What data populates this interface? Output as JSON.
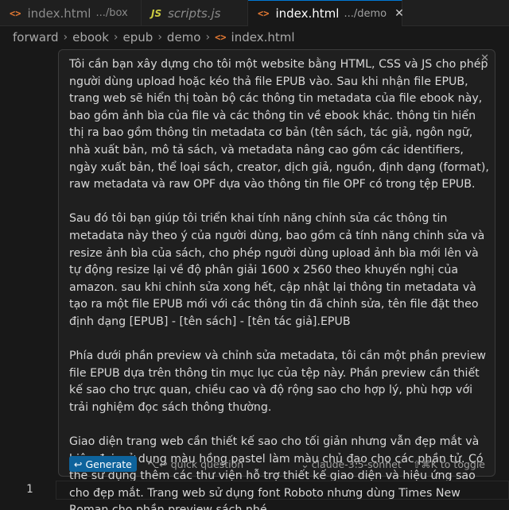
{
  "tabs": [
    {
      "icon": "<>",
      "name": "index.html",
      "desc": ".../box"
    },
    {
      "icon": "JS",
      "name": "scripts.js",
      "desc": ""
    },
    {
      "icon": "<>",
      "name": "index.html",
      "desc": ".../demo",
      "close": "✕"
    }
  ],
  "breadcrumb": {
    "items": [
      "forward",
      "ebook",
      "epub",
      "demo"
    ],
    "file_icon": "<>",
    "file": "index.html",
    "separator": "›"
  },
  "prompt": {
    "close": "✕",
    "paragraphs": [
      "Tôi cần bạn xây dựng cho tôi một website bằng HTML, CSS và JS cho phép người dùng upload hoặc kéo thả file EPUB vào. Sau khi nhận file EPUB, trang web sẽ hiển thị toàn bộ các thông tin metadata của file ebook này, bao gồm ảnh bìa của file và các thông tin về ebook khác. thông tin hiển thị ra bao gồm thông tin metadata cơ bản (tên sách, tác giả, ngôn ngữ, nhà xuất bản, mô tả sách, và metadata nâng cao gồm các identifiers, ngày xuất bản, thể loại sách, creator, dịch giả, nguồn, định dạng (format), raw metadata và raw OPF dựa vào thông tin file OPF có trong tệp EPUB.",
      "Sau đó tôi bạn giúp tôi triển khai tính năng chỉnh sửa các thông tin metadata này theo ý của người dùng, bao gồm cả tính năng chỉnh sửa và resize ảnh bìa của sách, cho phép người dùng upload ảnh bìa mới lên và tự động resize lại về độ phân giải 1600 x 2560 theo khuyến nghị của amazon. sau khi chỉnh sửa xong hết, cập nhật lại thông tin metadata và tạo ra một file EPUB mới với các thông tin đã chỉnh sửa, tên file đặt theo định dạng [EPUB] - [tên sách] - [tên tác giả].EPUB",
      "Phía dưới phần preview và chỉnh sửa metadata, tôi cần một phần preview file EPUB dựa trên thông tin mục lục của tệp này. Phần preview cần thiết kế sao cho trực quan, chiều cao và độ rộng sao cho hợp lý, phù hợp với trải nghiệm đọc sách thông thường.",
      "Giao diện trang web cần thiết kế sao cho tối giản nhưng vẫn đẹp mắt và hiện đại, sử dụng màu hồng pastel làm màu chủ đạo cho các phần tử. Có thể sử dụng thêm các thư viện hỗ trợ thiết kế giao diện và hiệu ứng sao cho đẹp mắt. Trang web sử dụng font Roboto nhưng dùng Times New Roman cho phần preview sách nhé"
    ],
    "generate_icon": "↩",
    "generate_label": "Generate",
    "quick_question": "⌥↩ quick question",
    "model_chevron": "⌄",
    "model": "claude-3.5-sonnet",
    "toggle": "⇧⌘K to toggle"
  },
  "editor": {
    "line_number": "1"
  },
  "colors": {
    "accent": "#0e639c",
    "panel": "#1f1f1f",
    "background": "#181818"
  }
}
